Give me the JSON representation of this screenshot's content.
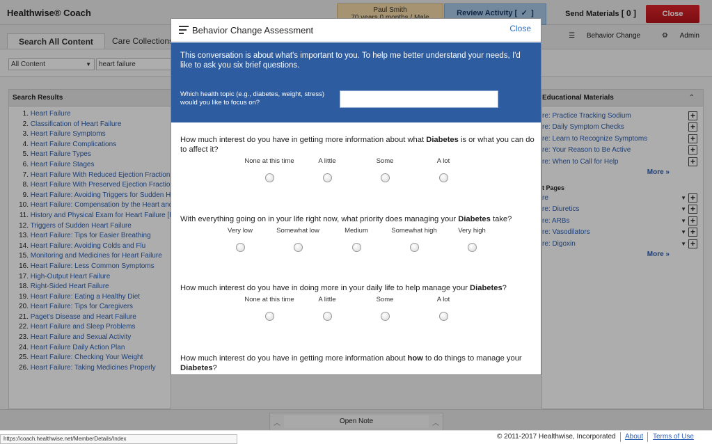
{
  "header": {
    "brand": "Healthwise® Coach",
    "patient_name": "Paul Smith",
    "patient_age": "70 years 0 months / Male",
    "review_label": "Review Activity",
    "review_check": "✓",
    "send_label": "Send Materials",
    "send_count": "[ 0 ]",
    "close_label": "Close"
  },
  "tabs": {
    "search_all": "Search All Content",
    "care_collections": "Care Collections"
  },
  "tools": {
    "behavior_change": "Behavior Change",
    "admin": "Admin"
  },
  "search": {
    "scope": "All Content",
    "query": "heart failure"
  },
  "results": {
    "title": "Search Results",
    "items": [
      {
        "n": "1.",
        "t": "Heart Failure"
      },
      {
        "n": "2.",
        "t": "Classification of Heart Failure"
      },
      {
        "n": "3.",
        "t": "Heart Failure Symptoms"
      },
      {
        "n": "4.",
        "t": "Heart Failure Complications"
      },
      {
        "n": "5.",
        "t": "Heart Failure Types"
      },
      {
        "n": "6.",
        "t": "Heart Failure Stages"
      },
      {
        "n": "7.",
        "t": "Heart Failure With Reduced Ejection Fraction"
      },
      {
        "n": "8.",
        "t": "Heart Failure With Preserved Ejection Fraction"
      },
      {
        "n": "9.",
        "t": "Heart Failure: Avoiding Triggers for Sudden H"
      },
      {
        "n": "10.",
        "t": "Heart Failure: Compensation by the Heart and"
      },
      {
        "n": "11.",
        "t": "History and Physical Exam for Heart Failure [M"
      },
      {
        "n": "12.",
        "t": "Triggers of Sudden Heart Failure"
      },
      {
        "n": "13.",
        "t": "Heart Failure: Tips for Easier Breathing"
      },
      {
        "n": "14.",
        "t": "Heart Failure: Avoiding Colds and Flu"
      },
      {
        "n": "15.",
        "t": "Monitoring and Medicines for Heart Failure"
      },
      {
        "n": "16.",
        "t": "Heart Failure: Less Common Symptoms"
      },
      {
        "n": "17.",
        "t": "High-Output Heart Failure"
      },
      {
        "n": "18.",
        "t": "Right-Sided Heart Failure"
      },
      {
        "n": "19.",
        "t": "Heart Failure: Eating a Healthy Diet"
      },
      {
        "n": "20.",
        "t": "Heart Failure: Tips for Caregivers"
      },
      {
        "n": "21.",
        "t": "Paget's Disease and Heart Failure"
      },
      {
        "n": "22.",
        "t": "Heart Failure and Sleep Problems"
      },
      {
        "n": "23.",
        "t": "Heart Failure and Sexual Activity"
      },
      {
        "n": "24.",
        "t": "Heart Failure Daily Action Plan"
      },
      {
        "n": "25.",
        "t": "Heart Failure: Checking Your Weight"
      },
      {
        "n": "26.",
        "t": "Heart Failure: Taking Medicines Properly"
      }
    ]
  },
  "education": {
    "title": "Educational Materials",
    "items": [
      "re: Practice Tracking Sodium",
      "re: Daily Symptom Checks",
      "re: Learn to Recognize Symptoms",
      "re: Your Reason to Be Active",
      "re: When to Call for Help"
    ],
    "more": "More »",
    "pages_title": "t Pages",
    "pages": [
      "re",
      "re: Diuretics",
      "re: ARBs",
      "re: Vasodilators",
      "re: Digoxin"
    ],
    "pages_more": "More »"
  },
  "modal": {
    "title": "Behavior Change Assessment",
    "close": "Close",
    "intro": "This conversation is about what's important to you. To help me better understand your needs, I'd like to ask you six brief questions.",
    "topic_question": "Which health topic (e.g., diabetes, weight, stress) would you like to focus on?",
    "topic_value": "",
    "topic_word": "Diabetes",
    "q1_before": "How much interest do you have in getting more information about what ",
    "q1_after": " is or what you can do to affect it?",
    "q2_before": "With everything going on in your life right now, what priority does managing your ",
    "q2_after": " take?",
    "q3_before": "How much interest do you have in doing more in your daily life to help manage your ",
    "q3_after": "?",
    "q4_before": "How much interest do you have in getting more information about ",
    "q4_how": "how",
    "q4_mid": " to do things to manage your ",
    "q4_after": "?",
    "interest_options": [
      "None at this time",
      "A little",
      "Some",
      "A lot"
    ],
    "priority_options": [
      "Very low",
      "Somewhat low",
      "Medium",
      "Somewhat high",
      "Very high"
    ]
  },
  "bottom": {
    "open_note": "Open Note",
    "status_url": "https://coach.healthwise.net/MemberDetails/Index",
    "copyright": "© 2011-2017 Healthwise, Incorporated",
    "about": "About",
    "terms": "Terms of Use"
  }
}
